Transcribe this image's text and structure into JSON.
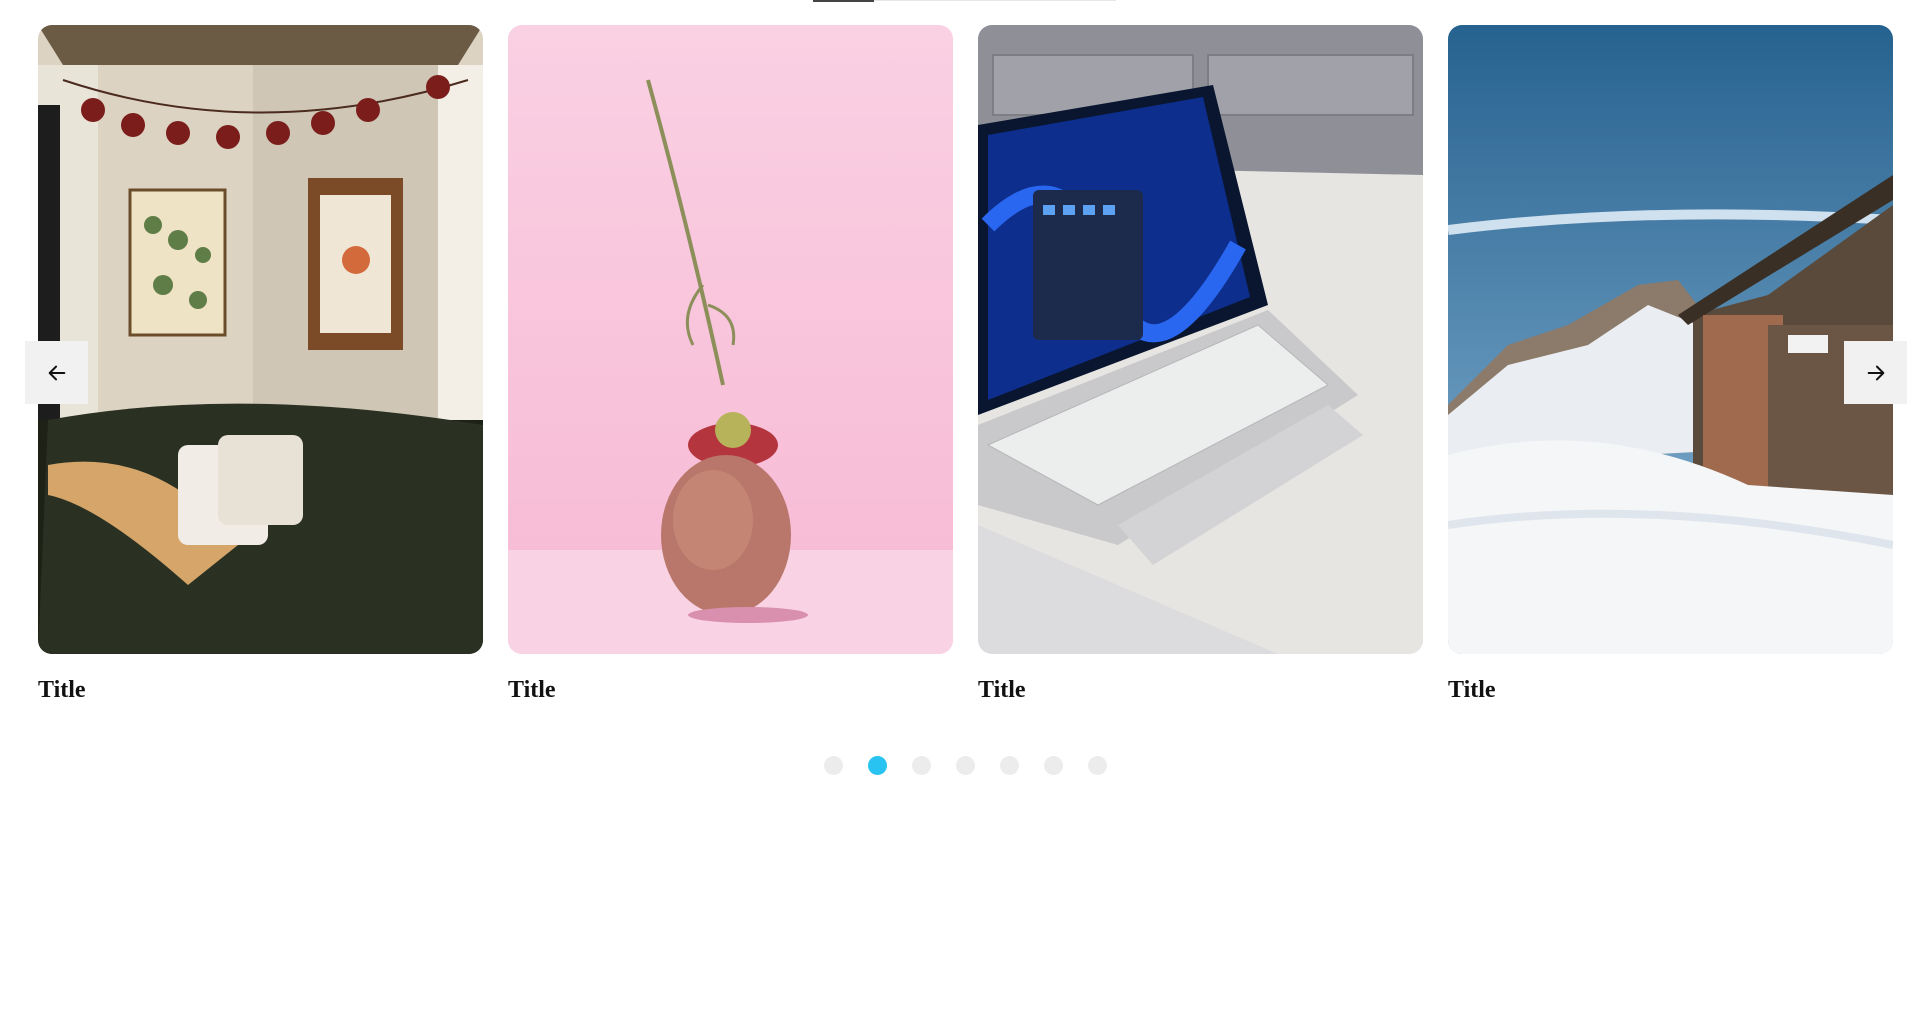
{
  "carousel": {
    "prev_icon": "arrow-left-icon",
    "next_icon": "arrow-right-icon",
    "slides": [
      {
        "title": "Title",
        "image": "living-room-corner-photo"
      },
      {
        "title": "Title",
        "image": "flower-on-rock-pink-photo"
      },
      {
        "title": "Title",
        "image": "laptop-on-counter-photo"
      },
      {
        "title": "Title",
        "image": "snowy-mountain-hut-photo"
      }
    ],
    "dots": {
      "count": 7,
      "active_index": 1
    },
    "accent_color": "#29c3f2"
  }
}
